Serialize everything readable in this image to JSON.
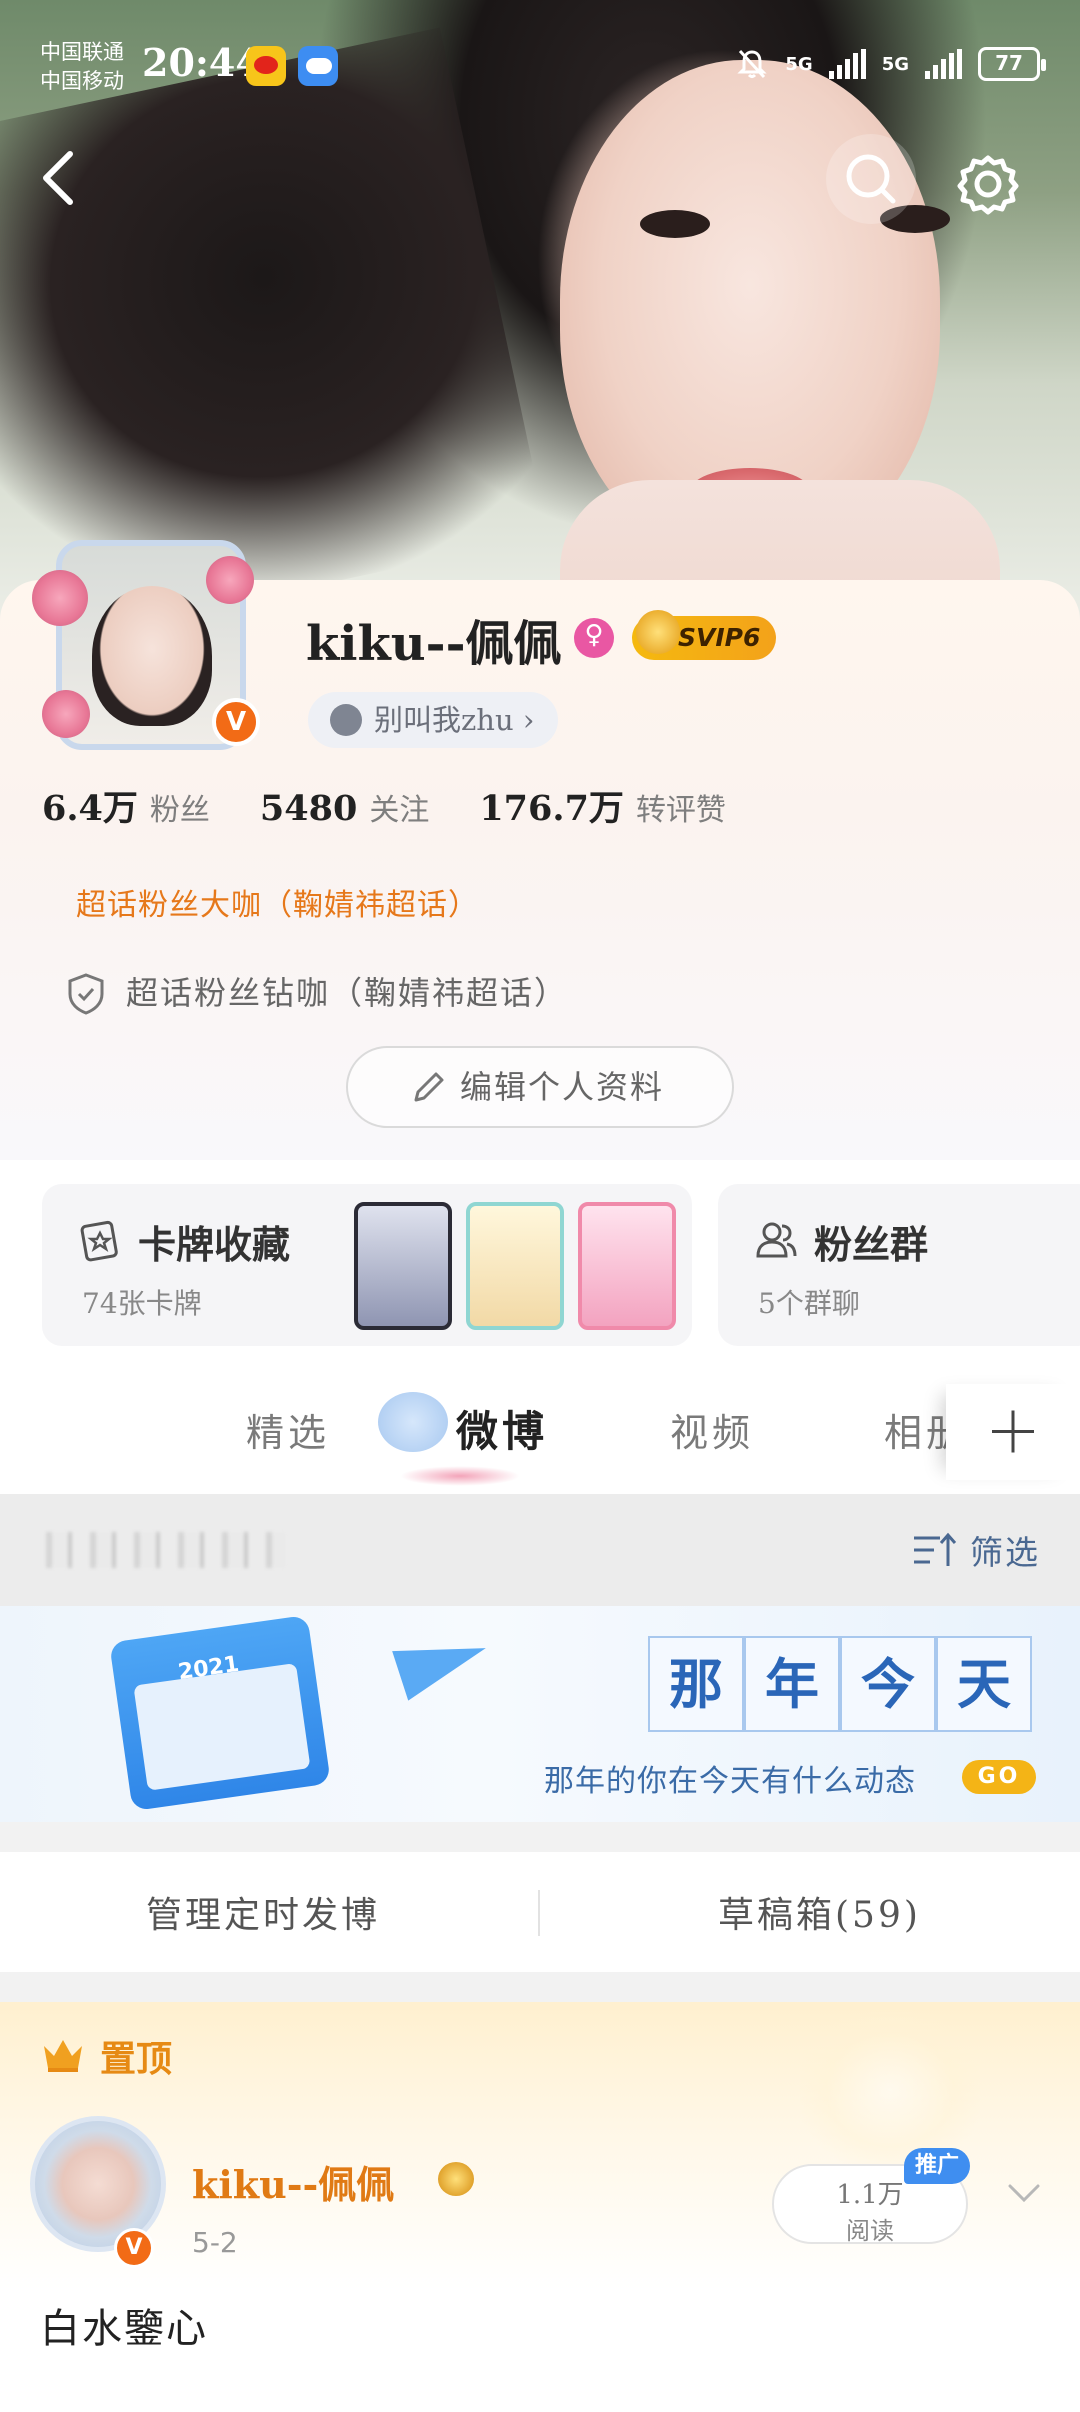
{
  "status_bar": {
    "carrier_1": "中国联通",
    "carrier_2": "中国移动",
    "time": "20:44",
    "network_1": "5G",
    "network_2": "5G",
    "battery": "77"
  },
  "profile": {
    "name": "kiku--佩佩",
    "vip_badge": "SVIP6",
    "verified_badge": "V",
    "remark": "别叫我zhu",
    "stats": [
      {
        "value": "6.4万",
        "label": "粉丝"
      },
      {
        "value": "5480",
        "label": "关注"
      },
      {
        "value": "176.7万",
        "label": "转评赞"
      }
    ],
    "super_topic_1": "超话粉丝大咖（鞠婧祎超话）",
    "super_topic_2": "超话粉丝钻咖（鞠婧祎超话）",
    "edit_button": "编辑个人资料"
  },
  "cards": {
    "card_collection": {
      "title": "卡牌收藏",
      "subtitle": "74张卡牌"
    },
    "fan_group": {
      "title": "粉丝群",
      "subtitle": "5个群聊"
    }
  },
  "tabs": [
    {
      "label": "精选",
      "active": false
    },
    {
      "label": "微博",
      "active": true
    },
    {
      "label": "视频",
      "active": false
    },
    {
      "label": "相册",
      "active": false
    }
  ],
  "filter": {
    "label": "筛选"
  },
  "on_this_day": {
    "calendar_year": "2021",
    "chars": [
      "那",
      "年",
      "今",
      "天"
    ],
    "subtitle": "那年的你在今天有什么动态",
    "go_label": "GO"
  },
  "manage": {
    "scheduled": "管理定时发博",
    "drafts": "草稿箱(59)"
  },
  "pinned_post": {
    "label": "置顶",
    "author": "kiku--佩佩",
    "date": "5-2",
    "reads_value": "1.1万",
    "reads_label": "阅读",
    "promo_label": "推广",
    "text": "白水鑒心"
  },
  "colors": {
    "accent_orange": "#e6781a",
    "vip_gold": "#f5b90f",
    "link_blue": "#4a6891",
    "verified_orange": "#f26b16"
  }
}
